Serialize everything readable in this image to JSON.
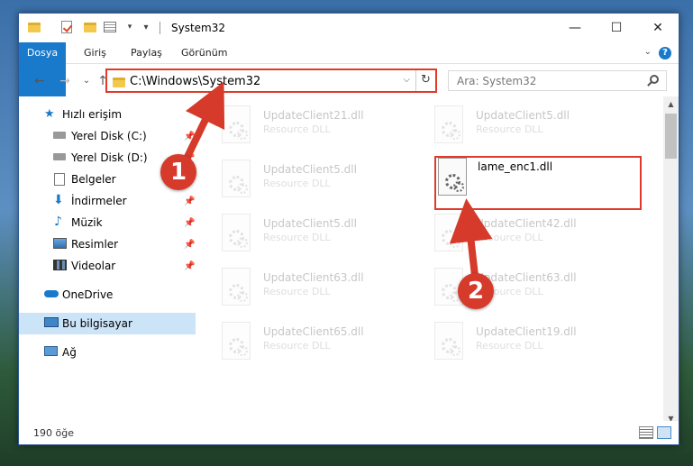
{
  "window": {
    "title": "System32",
    "controls": {
      "minimize": "—",
      "maximize": "☐",
      "close": "✕"
    }
  },
  "ribbon": {
    "tabs": [
      "Dosya",
      "Giriş",
      "Paylaş",
      "Görünüm"
    ],
    "help": "?"
  },
  "address_bar": {
    "path": "C:\\Windows\\System32",
    "dropdown": "⌵",
    "refresh": "↻"
  },
  "nav_buttons": {
    "back": "←",
    "forward": "→",
    "recent": "⌄",
    "up": "↑"
  },
  "search": {
    "placeholder": "Ara: System32"
  },
  "navigation_pane": {
    "items": [
      {
        "label": "Hızlı erişim",
        "icon": "star-icon"
      },
      {
        "label": "Yerel Disk (C:)",
        "icon": "drive-icon",
        "pinned": true
      },
      {
        "label": "Yerel Disk (D:)",
        "icon": "drive-icon",
        "pinned": true
      },
      {
        "label": "Belgeler",
        "icon": "documents-icon",
        "pinned": true
      },
      {
        "label": "İndirmeler",
        "icon": "download-icon",
        "pinned": true
      },
      {
        "label": "Müzik",
        "icon": "music-icon",
        "pinned": true
      },
      {
        "label": "Resimler",
        "icon": "pictures-icon",
        "pinned": true
      },
      {
        "label": "Videolar",
        "icon": "videos-icon",
        "pinned": true
      },
      {
        "label": "OneDrive",
        "icon": "onedrive-icon"
      },
      {
        "label": "Bu bilgisayar",
        "icon": "computer-icon",
        "selected": true
      },
      {
        "label": "Ağ",
        "icon": "network-icon"
      }
    ]
  },
  "files": [
    {
      "name": "UpdateClient21.dll",
      "type": "Resource DLL"
    },
    {
      "name": "UpdateClient5.dll",
      "type": "Resource DLL"
    },
    {
      "name": "UpdateClient5.dll",
      "type": "Resource DLL"
    },
    {
      "name": "lame_enc1.dll",
      "type": ""
    },
    {
      "name": "UpdateClient5.dll",
      "type": "Resource DLL"
    },
    {
      "name": "UpdateClient42.dll",
      "type": "Resource DLL"
    },
    {
      "name": "UpdateClient63.dll",
      "type": "Resource DLL"
    },
    {
      "name": "UpdateClient63.dll",
      "type": "Resource DLL"
    },
    {
      "name": "UpdateClient65.dll",
      "type": "Resource DLL"
    },
    {
      "name": "UpdateClient19.dll",
      "type": "Resource DLL"
    }
  ],
  "status_bar": {
    "item_count": "190 öğe"
  },
  "callouts": {
    "one": "1",
    "two": "2"
  },
  "colors": {
    "accent": "#1979ca",
    "highlight": "#e03a2a",
    "selected_nav": "#cce4f7"
  }
}
